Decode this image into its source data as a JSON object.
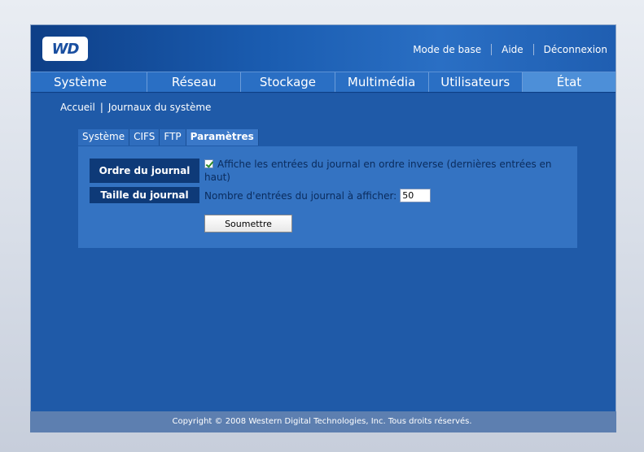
{
  "header": {
    "logo_text": "WD",
    "links": [
      "Mode de base",
      "Aide",
      "Déconnexion"
    ]
  },
  "nav": {
    "items": [
      "Système",
      "Réseau",
      "Stockage",
      "Multimédia",
      "Utilisateurs",
      "État"
    ],
    "active_index": 5
  },
  "breadcrumb": {
    "home": "Accueil",
    "separator": "|",
    "current": "Journaux du système"
  },
  "subtabs": {
    "items": [
      "Système",
      "CIFS",
      "FTP",
      "Paramètres"
    ],
    "active_index": 3
  },
  "form": {
    "order_label": "Ordre du journal",
    "order_checkbox_checked": true,
    "order_text": "Affiche les entrées du journal en ordre inverse (dernières entrées en haut)",
    "size_label": "Taille du journal",
    "size_text": "Nombre d'entrées du journal à afficher:",
    "size_value": "50",
    "submit_label": "Soumettre"
  },
  "footer": {
    "copyright": "Copyright © 2008 Western Digital Technologies, Inc. Tous droits réservés."
  },
  "colors": {
    "accent": "#1f5aa8",
    "nav_active": "#4d8fd8",
    "label_bg": "#0e3a78"
  }
}
